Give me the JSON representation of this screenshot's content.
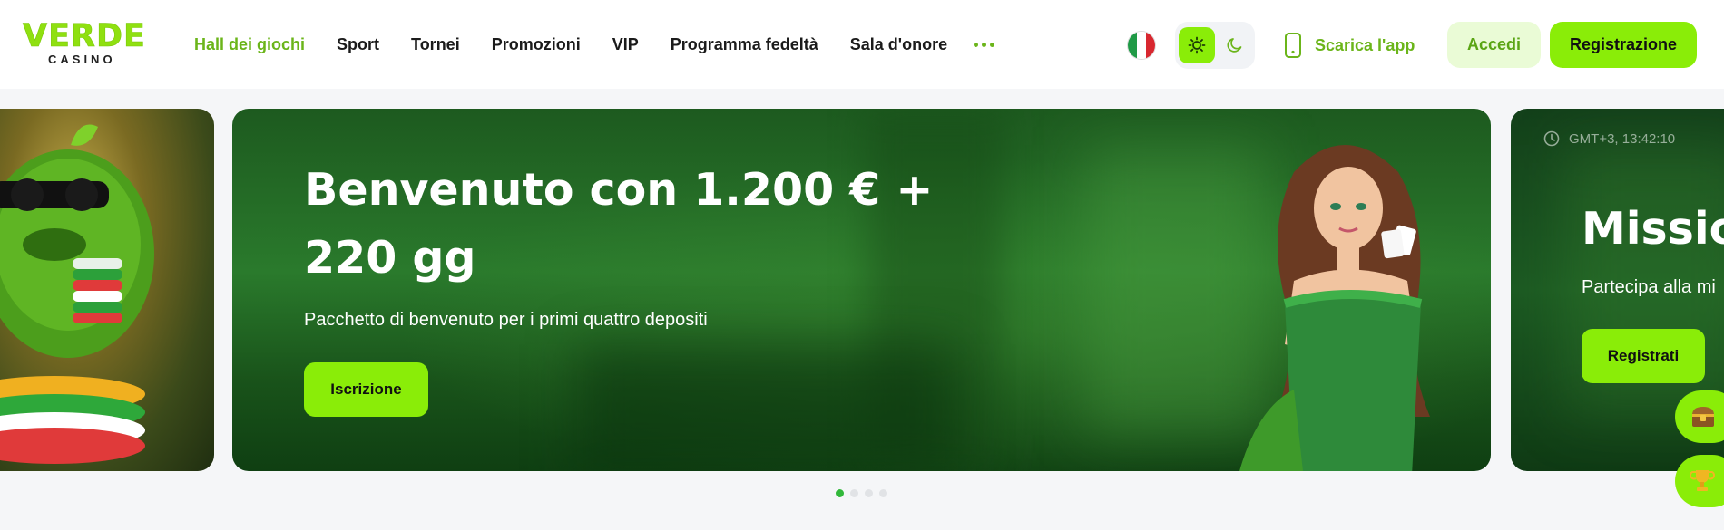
{
  "brand": {
    "logo_main": "VERDE",
    "logo_sub": "CASINO",
    "accent_color": "#8aed08",
    "active_color": "#6bb51a"
  },
  "nav": {
    "items": [
      {
        "label": "Hall dei giochi",
        "active": true
      },
      {
        "label": "Sport"
      },
      {
        "label": "Tornei"
      },
      {
        "label": "Promozioni"
      },
      {
        "label": "VIP"
      },
      {
        "label": "Programma fedeltà"
      },
      {
        "label": "Sala d'onore"
      }
    ],
    "more_icon": "more-dots-icon"
  },
  "header_right": {
    "language_flag": "italy-flag-icon",
    "theme": {
      "selected": "light",
      "light_icon": "sun-icon",
      "dark_icon": "moon-icon"
    },
    "app_link_label": "Scarica l'app",
    "app_icon": "smartphone-icon",
    "login_label": "Accedi",
    "register_label": "Registrazione"
  },
  "carousel": {
    "main": {
      "title": "Benvenuto con 1.200 € + 220 gg",
      "subtitle": "Pacchetto di benvenuto per i primi quattro depositi",
      "cta": "Iscrizione"
    },
    "next": {
      "time": "GMT+3,  13:42:10",
      "title": "Missio",
      "subtitle": "Partecipa alla mi",
      "cta": "Registrati"
    },
    "dots_count": 4,
    "active_dot": 1
  },
  "floating": {
    "chest_icon": "treasure-chest-icon",
    "trophy_icon": "trophy-icon"
  }
}
